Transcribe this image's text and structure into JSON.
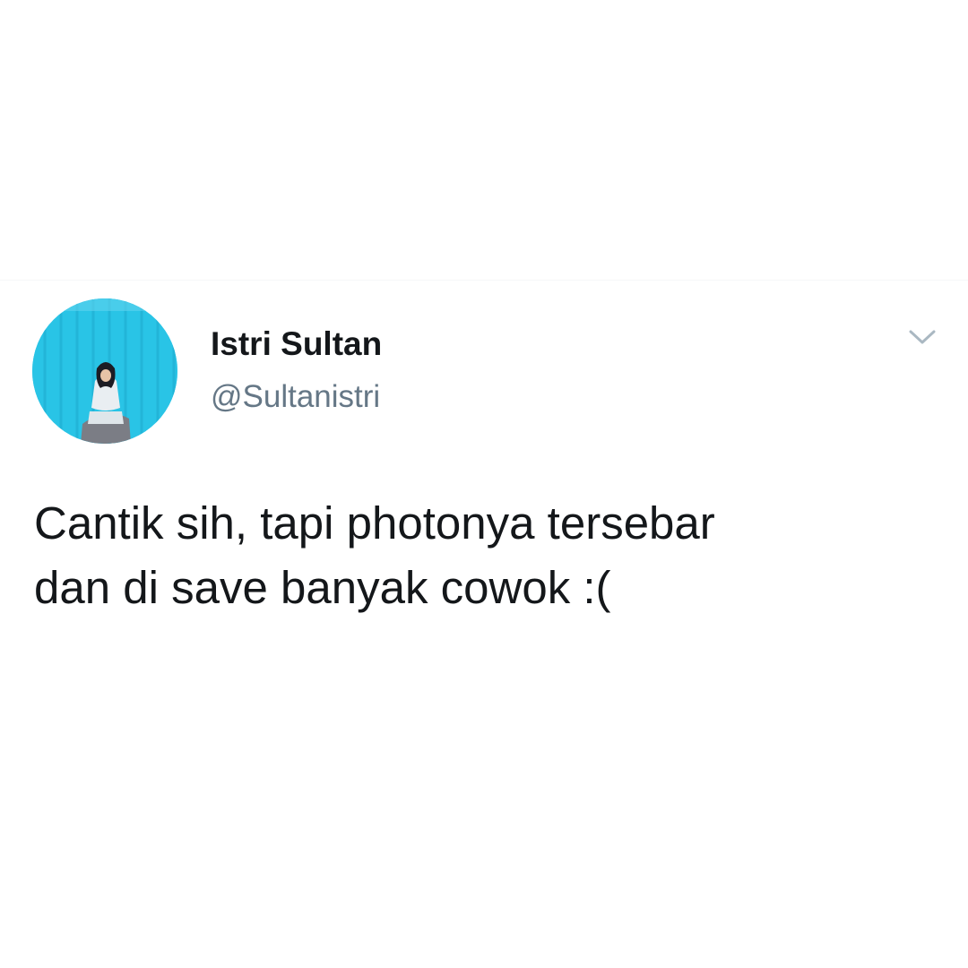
{
  "tweet": {
    "author": {
      "display_name": "Istri Sultan",
      "handle": "@Sultanistri",
      "avatar": "profile-photo"
    },
    "text": "Cantik sih, tapi photonya tersebar\ndan di save banyak cowok :(",
    "menu_icon": "chevron-down-icon"
  },
  "colors": {
    "background": "#ffffff",
    "text_primary": "#14171a",
    "text_secondary": "#657786",
    "chevron": "#aab8c2",
    "avatar_backdrop": "#29c4e6"
  }
}
